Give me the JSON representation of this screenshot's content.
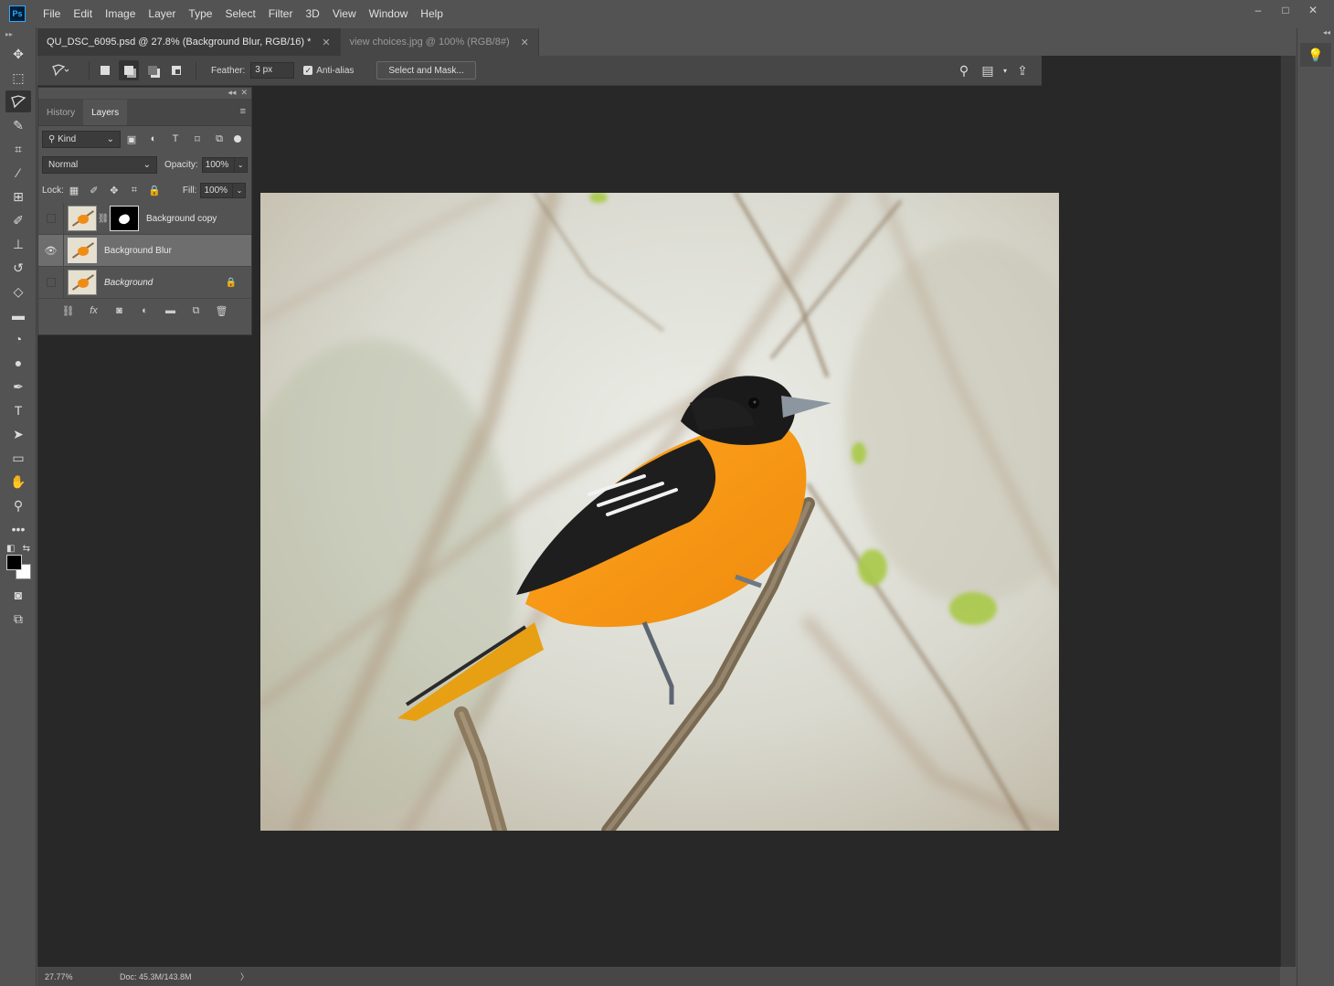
{
  "app": {
    "logo": "Ps"
  },
  "menu": [
    "File",
    "Edit",
    "Image",
    "Layer",
    "Type",
    "Select",
    "Filter",
    "3D",
    "View",
    "Window",
    "Help"
  ],
  "window_controls": {
    "minimize": "–",
    "maximize": "□",
    "close": "✕"
  },
  "toolbar_tools": [
    "move-icon",
    "marquee-icon",
    "lasso-icon",
    "quick-selection-icon",
    "crop-icon",
    "eyedropper-icon",
    "healing-brush-icon",
    "brush-icon",
    "clone-stamp-icon",
    "history-brush-icon",
    "eraser-icon",
    "gradient-icon",
    "blur-icon",
    "dodge-icon",
    "pen-icon",
    "type-icon",
    "path-selection-icon",
    "rectangle-icon",
    "hand-icon",
    "zoom-icon",
    "more-tools-icon"
  ],
  "colors": {
    "foreground": "#000000",
    "background": "#ffffff",
    "canvas_bg": "#282828",
    "panel_bg": "#535353"
  },
  "tabs": [
    {
      "label": "QU_DSC_6095.psd @ 27.8% (Background Blur, RGB/16) *",
      "active": true,
      "close": "✕"
    },
    {
      "label": "view choices.jpg @ 100% (RGB/8#)",
      "active": false,
      "close": "✕"
    }
  ],
  "options": {
    "feather_label": "Feather:",
    "feather_value": "3 px",
    "antialias_label": "Anti-alias",
    "antialias_checked": true,
    "select_mask_label": "Select and Mask..."
  },
  "layers_panel": {
    "tabs": [
      "History",
      "Layers"
    ],
    "active_tab": "Layers",
    "filter_kind": "Kind",
    "blend_mode": "Normal",
    "opacity_label": "Opacity:",
    "opacity_value": "100%",
    "lock_label": "Lock:",
    "fill_label": "Fill:",
    "fill_value": "100%",
    "layers": [
      {
        "name": "Background copy",
        "visible": false,
        "has_mask": true,
        "selected": false,
        "locked": false,
        "italic": false
      },
      {
        "name": "Background Blur",
        "visible": true,
        "has_mask": false,
        "selected": true,
        "locked": false,
        "italic": false
      },
      {
        "name": "Background",
        "visible": false,
        "has_mask": false,
        "selected": false,
        "locked": true,
        "italic": true
      }
    ]
  },
  "status": {
    "zoom": "27.77%",
    "doc": "Doc: 45.3M/143.8M",
    "arrow": "〉"
  }
}
